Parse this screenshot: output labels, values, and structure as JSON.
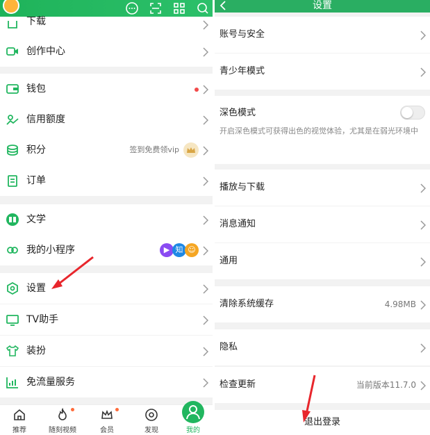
{
  "left": {
    "menu": [
      {
        "label": "下载",
        "icon": "download-icon"
      },
      {
        "label": "创作中心",
        "icon": "video-icon"
      },
      {
        "label": "钱包",
        "icon": "wallet-icon"
      },
      {
        "label": "信用额度",
        "icon": "credit-icon"
      },
      {
        "label": "积分",
        "icon": "points-icon",
        "hint": "签到免费领vip"
      },
      {
        "label": "订单",
        "icon": "order-icon"
      },
      {
        "label": "文学",
        "icon": "book-icon"
      },
      {
        "label": "我的小程序",
        "icon": "link-icon"
      },
      {
        "label": "设置",
        "icon": "settings-icon"
      },
      {
        "label": "TV助手",
        "icon": "tv-icon"
      },
      {
        "label": "装扮",
        "icon": "shirt-icon"
      },
      {
        "label": "免流量服务",
        "icon": "data-icon"
      }
    ],
    "mini_badge": "知",
    "tabs": [
      {
        "label": "推荐"
      },
      {
        "label": "随刻视频"
      },
      {
        "label": "会员"
      },
      {
        "label": "发现"
      },
      {
        "label": "我的"
      }
    ]
  },
  "right": {
    "title": "设置",
    "rows": {
      "account": "账号与安全",
      "youth": "青少年模式",
      "dark": "深色模式",
      "dark_desc": "开启深色模式可获得出色的视觉体验，尤其是在弱光环境中",
      "play": "播放与下载",
      "notify": "消息通知",
      "general": "通用",
      "cache": "清除系统缓存",
      "cache_size": "4.98MB",
      "privacy": "隐私",
      "update": "检查更新",
      "version": "当前版本11.7.0",
      "logout": "退出登录"
    }
  },
  "colors": {
    "accent": "#21b65f",
    "dot": "#f24a4a"
  }
}
